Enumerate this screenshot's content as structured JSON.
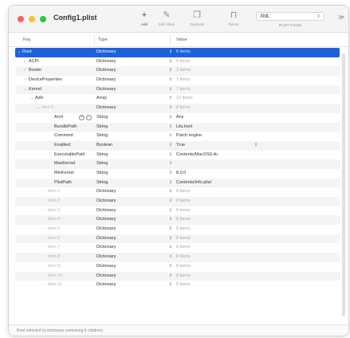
{
  "window": {
    "title": "Config1.plist"
  },
  "toolbar": {
    "add_label": "Add",
    "edit_label": "Edit Value",
    "duplicate_label": "Duplicate",
    "delete_label": "Delete",
    "format_value": "XML",
    "format_label": "PLIST Format",
    "more_glyph": "≫"
  },
  "columns": {
    "key": "Key",
    "type": "Type",
    "value": "Value"
  },
  "rows": [
    {
      "key": "Root",
      "type": "Dictionary",
      "value": "6 items"
    },
    {
      "key": "ACPI",
      "type": "Dictionary",
      "value": "6 items"
    },
    {
      "key": "Booter",
      "type": "Dictionary",
      "value": "3 items"
    },
    {
      "key": "DeviceProperties",
      "type": "Dictionary",
      "value": "2 items"
    },
    {
      "key": "Kernel",
      "type": "Dictionary",
      "value": "7 items"
    },
    {
      "key": "Add",
      "type": "Array",
      "value": "12 items"
    },
    {
      "key": "Item 0",
      "type": "Dictionary",
      "value": "8 items"
    },
    {
      "key": "Arch",
      "type": "String",
      "value": "Any"
    },
    {
      "key": "BundlePath",
      "type": "String",
      "value": "Lilu.kext"
    },
    {
      "key": "Comment",
      "type": "String",
      "value": "Patch engine"
    },
    {
      "key": "Enabled",
      "type": "Boolean",
      "value": "True"
    },
    {
      "key": "ExecutablePath",
      "type": "String",
      "value": "Contents/MacOS/Lilu"
    },
    {
      "key": "MaxKernel",
      "type": "String",
      "value": ""
    },
    {
      "key": "MinKernel",
      "type": "String",
      "value": "8.0.0"
    },
    {
      "key": "PlistPath",
      "type": "String",
      "value": "Contents/Info.plist"
    },
    {
      "key": "Item 1",
      "type": "Dictionary",
      "value": "8 items"
    },
    {
      "key": "Item 2",
      "type": "Dictionary",
      "value": "8 items"
    },
    {
      "key": "Item 3",
      "type": "Dictionary",
      "value": "8 items"
    },
    {
      "key": "Item 4",
      "type": "Dictionary",
      "value": "8 items"
    },
    {
      "key": "Item 5",
      "type": "Dictionary",
      "value": "8 items"
    },
    {
      "key": "Item 6",
      "type": "Dictionary",
      "value": "8 items"
    },
    {
      "key": "Item 7",
      "type": "Dictionary",
      "value": "8 items"
    },
    {
      "key": "Item 8",
      "type": "Dictionary",
      "value": "8 items"
    },
    {
      "key": "Item 9",
      "type": "Dictionary",
      "value": "8 items"
    },
    {
      "key": "Item 10",
      "type": "Dictionary",
      "value": "8 items"
    },
    {
      "key": "Item 11",
      "type": "Dictionary",
      "value": "8 items"
    }
  ],
  "status": {
    "text": "Root selected (a dictionary containing 6 children)"
  },
  "icons": {
    "add": "plus-icon",
    "edit": "pencil-icon",
    "duplicate": "duplicate-icon",
    "delete": "trash-icon"
  },
  "colors": {
    "selection": "#1d62db",
    "close": "#fe5f57",
    "minimize": "#febc2e",
    "zoom": "#28c840"
  }
}
